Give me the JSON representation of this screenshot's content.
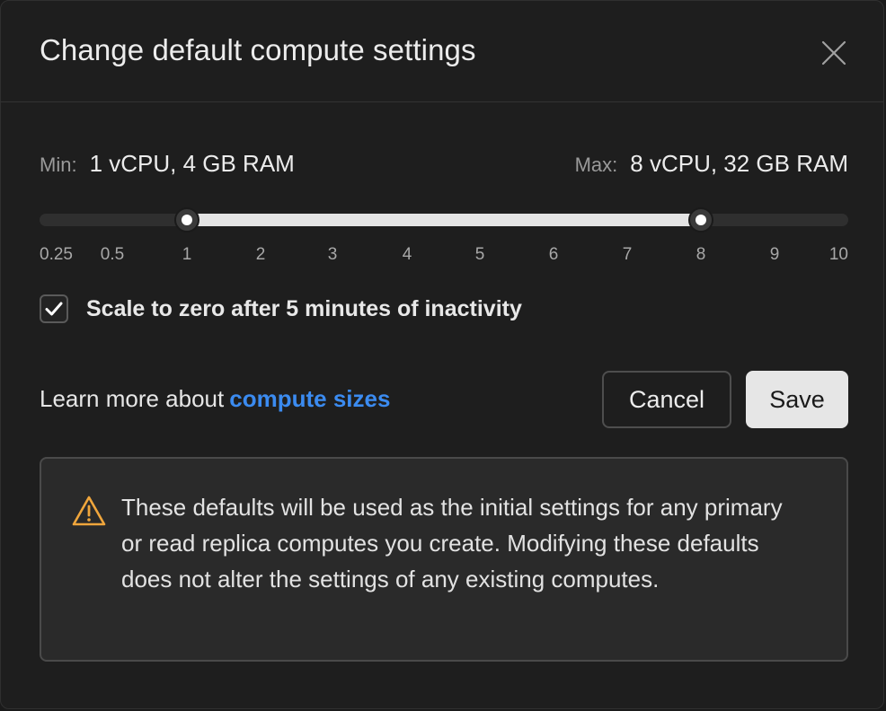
{
  "dialog": {
    "title": "Change default compute settings",
    "close_icon": "close-icon"
  },
  "range": {
    "min_label": "Min:",
    "min_value": "1 vCPU, 4 GB RAM",
    "max_label": "Max:",
    "max_value": "8 vCPU, 32 GB RAM"
  },
  "slider": {
    "ticks": [
      "0.25",
      "0.5",
      "1",
      "2",
      "3",
      "4",
      "5",
      "6",
      "7",
      "8",
      "9",
      "10"
    ],
    "selected_min": "1",
    "selected_max": "8",
    "fill_color": "#e4e4e4",
    "track_color": "#2f2f2f"
  },
  "scale_to_zero": {
    "label": "Scale to zero after 5 minutes of inactivity",
    "checked": true
  },
  "learn_more": {
    "text": "Learn more about",
    "link": "compute sizes",
    "link_color": "#3b8bf0"
  },
  "buttons": {
    "cancel": "Cancel",
    "save": "Save"
  },
  "notice": {
    "icon": "warning-icon",
    "icon_color": "#f0a63c",
    "text": "These defaults will be used as the initial settings for any primary or read replica computes you create. Modifying these defaults does not alter the settings of any existing computes."
  }
}
